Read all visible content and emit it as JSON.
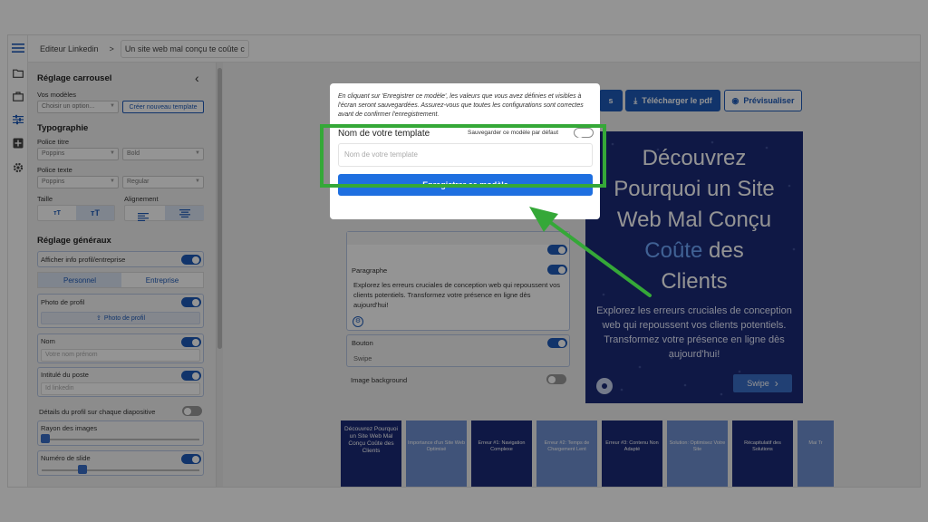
{
  "topbar": {
    "crumb1": "Editeur Linkedin",
    "crumb_sep": ">",
    "crumb2": "Un site web mal conçu te coûte c"
  },
  "panel": {
    "title": "Réglage carrousel",
    "collapse_chevron": "‹",
    "models_label": "Vos modèles",
    "models_placeholder": "Choisir un option...",
    "create_template": "Créer nouveau template",
    "typography_title": "Typographie",
    "title_font_label": "Police titre",
    "title_font": "Poppins",
    "title_weight": "Bold",
    "text_font_label": "Police texte",
    "text_font": "Poppins",
    "text_weight": "Regular",
    "size_label": "Taille",
    "align_label": "Alignement",
    "general_title": "Réglage généraux",
    "show_profile": "Afficher info profil/entreprise",
    "tab_personal": "Personnel",
    "tab_company": "Entreprise",
    "photo_label": "Photo de profil",
    "photo_button": "Photo de profil",
    "name_label": "Nom",
    "name_placeholder": "Votre nom prénom",
    "job_label": "Intitulé du poste",
    "job_placeholder": "Id linkedin",
    "profile_each_slide": "Détails du profil sur chaque diapositive",
    "image_radius": "Rayon des images",
    "slide_number": "Numéro de slide"
  },
  "editor": {
    "paragraph_label": "Paragraphe",
    "paragraph_text": "Explorez les erreurs cruciales de conception web qui repoussent vos clients potentiels. Transformez votre présence en ligne dès aujourd'hui!",
    "button_label": "Bouton",
    "button_value": "Swipe",
    "image_bg_label": "Image background"
  },
  "toolbar": {
    "download_pdf": "Télécharger le pdf",
    "preview": "Prévisualiser",
    "partial_button": "s"
  },
  "slide": {
    "title_l1": "Découvrez",
    "title_l2": "Pourquoi un Site",
    "title_l3": "Web Mal Conçu",
    "title_l4_highlight": "Coûte",
    "title_l4_rest": " des",
    "title_l5": "Clients",
    "paragraph": "Explorez les erreurs cruciales de conception web qui repoussent vos clients potentiels. Transformez votre présence en ligne dès aujourd'hui!",
    "swipe": "Swipe",
    "swipe_arrow": "›"
  },
  "thumbnails": [
    {
      "title": "Découvrez Pourquoi un Site Web Mal Conçu Coûte des Clients"
    },
    {
      "title": "Importance d'un Site Web Optimisé"
    },
    {
      "title": "Erreur #1: Navigation Complexe"
    },
    {
      "title": "Erreur #2: Temps de Chargement Lent"
    },
    {
      "title": "Erreur #3: Contenu Non Adapté"
    },
    {
      "title": "Solution: Optimisez Votre Site"
    },
    {
      "title": "Récapitulatif des Solutions"
    },
    {
      "title": "Mai Tr"
    }
  ],
  "modal": {
    "info_text": "En cliquant sur 'Enregistrer ce modèle', les valeurs que vous avez définies et visibles à l'écran seront sauvegardées. Assurez-vous que toutes les configurations sont correctes avant de confirmer l'enregistrement.",
    "name_label": "Nom de votre template",
    "default_label": "Sauvegarder ce modèle par défaut",
    "name_placeholder": "Nom de votre template",
    "save_button": "Enregistrer ce modèle"
  },
  "colors": {
    "accent": "#1e5bb8",
    "slide_bg": "#1b2a78",
    "highlight": "#6fa8ff",
    "annotation": "#35a838"
  }
}
